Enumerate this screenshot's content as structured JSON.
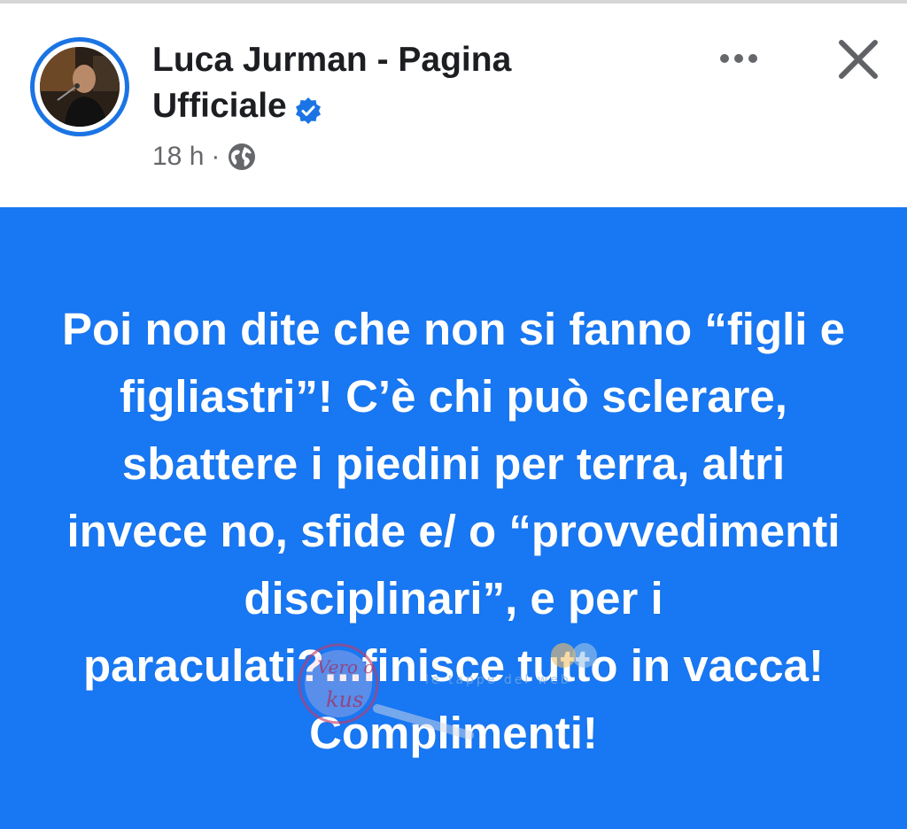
{
  "post": {
    "author": "Luca Jurman - Pagina Ufficiale",
    "time": "18 h",
    "separator": "·",
    "privacy_icon": "globe-icon",
    "verified_icon": "verified-badge-icon",
    "text": "Poi non dite che non si fanno “figli e figliastri”! C’è chi può sclerare, sbattere i piedini per terra, altri invece no,  sfide e/ o “provvedimenti disciplinari”, e per i paraculati?...finisce tutto in vacca! Complimenti!",
    "background_color": "#1877f2"
  },
  "header": {
    "more_icon": "more-options-icon",
    "close_icon": "close-icon"
  },
  "watermark": {
    "text_top": "Vero o",
    "text_bottom": "kus",
    "text_side": "le tappe del web"
  },
  "colors": {
    "accent": "#1b74e4",
    "post_background": "#1877f2",
    "text_primary": "#1c1e21",
    "text_secondary": "#65676b"
  }
}
